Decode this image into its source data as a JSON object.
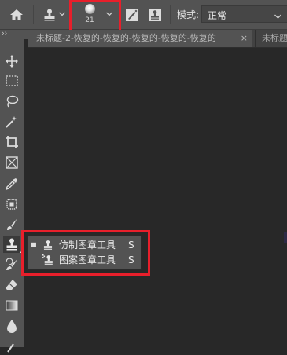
{
  "options_bar": {
    "brush_size": "21",
    "mode_label": "模式:",
    "mode_value": "正常"
  },
  "tabs": {
    "active_title": "未标题-2-恢复的-恢复的-恢复的-恢复的-恢复的",
    "active_close": "×",
    "next_title": "未标题"
  },
  "collapse_label": "››",
  "flyout": {
    "items": [
      {
        "label": "仿制图章工具",
        "shortcut": "S",
        "mark": "■"
      },
      {
        "label": "图案图章工具",
        "shortcut": "S",
        "mark": ""
      }
    ]
  },
  "colors": {
    "highlight_box": "#e81f2b",
    "panel": "#535353",
    "canvas": "#282828"
  }
}
